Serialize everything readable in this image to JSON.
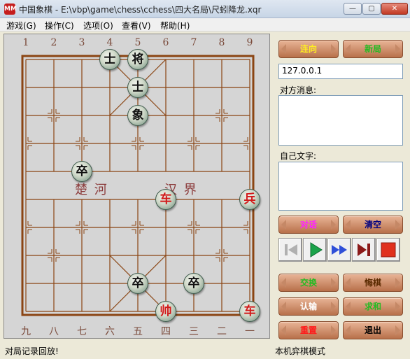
{
  "window": {
    "app_icon_text": "MM",
    "title": "中国象棋 - E:\\vbp\\game\\chess\\cchess\\四大名局\\尺蚓降龙.xqr",
    "minimize_glyph": "—",
    "maximize_glyph": "▢",
    "close_glyph": "✕"
  },
  "menu": [
    {
      "label": "游戏(G)"
    },
    {
      "label": "操作(C)"
    },
    {
      "label": "选项(O)"
    },
    {
      "label": "查看(V)"
    },
    {
      "label": "帮助(H)"
    }
  ],
  "board": {
    "top_files": [
      "1",
      "2",
      "3",
      "4",
      "5",
      "6",
      "7",
      "8",
      "9"
    ],
    "bottom_files": [
      "九",
      "八",
      "七",
      "六",
      "五",
      "四",
      "三",
      "二",
      "一"
    ],
    "river_left": "楚 河",
    "river_right": "汉 界",
    "pieces": [
      {
        "char": "士",
        "side": "black",
        "col": 4,
        "row": 0
      },
      {
        "char": "将",
        "side": "black",
        "col": 5,
        "row": 0
      },
      {
        "char": "士",
        "side": "black",
        "col": 5,
        "row": 1
      },
      {
        "char": "象",
        "side": "black",
        "col": 5,
        "row": 2
      },
      {
        "char": "卒",
        "side": "black",
        "col": 3,
        "row": 4
      },
      {
        "char": "车",
        "side": "red",
        "col": 6,
        "row": 5
      },
      {
        "char": "兵",
        "side": "red",
        "col": 9,
        "row": 5
      },
      {
        "char": "卒",
        "side": "black",
        "col": 5,
        "row": 8
      },
      {
        "char": "卒",
        "side": "black",
        "col": 7,
        "row": 8
      },
      {
        "char": "帅",
        "side": "red",
        "col": 6,
        "row": 9
      },
      {
        "char": "车",
        "side": "red",
        "col": 9,
        "row": 9
      }
    ]
  },
  "sidebar": {
    "connect_label": "连向",
    "new_game_label": "新局",
    "ip_value": "127.0.0.1",
    "opponent_message_label": "对方消息:",
    "own_text_label": "自己文字:",
    "dialog_label": "对话",
    "clear_label": "清空",
    "exchange_label": "交换",
    "undo_label": "悔棋",
    "resign_label": "认输",
    "draw_label": "求和",
    "reset_label": "重置",
    "exit_label": "退出"
  },
  "status": {
    "left": "对局记录回放!",
    "right": "本机弈棋模式"
  },
  "colors": {
    "board_line": "#8b4513",
    "red_piece_text": "#d11a1a",
    "yellow_button_text": "#ffee22",
    "magenta_button_text": "#ff22ff",
    "navy_button_text": "#000080",
    "green_button_text": "#22bb22",
    "red_button_text": "#ff1a1a",
    "brown_button_text": "#5a2a00"
  }
}
